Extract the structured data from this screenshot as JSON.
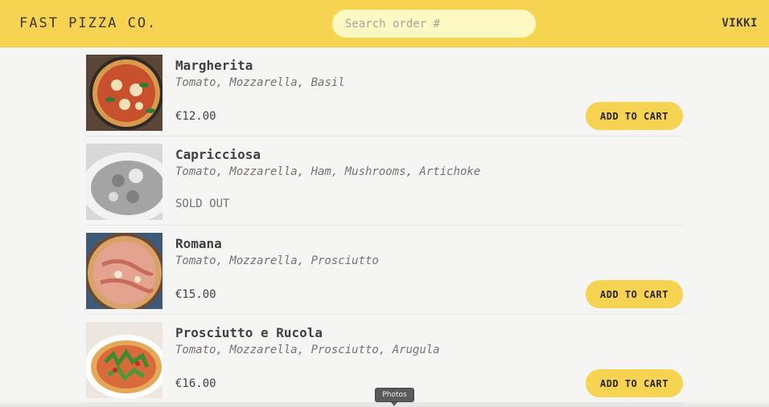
{
  "header": {
    "brand": "FAST PIZZA CO.",
    "search_placeholder": "Search order #",
    "username": "VIKKI"
  },
  "menu": {
    "items": [
      {
        "name": "Margherita",
        "ingredients": "Tomato, Mozzarella, Basil",
        "price": "€12.00",
        "button": "ADD TO CART",
        "sold_out": false
      },
      {
        "name": "Capricciosa",
        "ingredients": "Tomato, Mozzarella, Ham, Mushrooms, Artichoke",
        "status": "SOLD OUT",
        "sold_out": true
      },
      {
        "name": "Romana",
        "ingredients": "Tomato, Mozzarella, Prosciutto",
        "price": "€15.00",
        "button": "ADD TO CART",
        "sold_out": false
      },
      {
        "name": "Prosciutto e Rucola",
        "ingredients": "Tomato, Mozzarella, Prosciutto, Arugula",
        "price": "€16.00",
        "button": "ADD TO CART",
        "sold_out": false
      }
    ]
  },
  "tooltip": {
    "label": "Photos"
  },
  "colors": {
    "accent": "#f7d352",
    "background": "#f5f5f4",
    "search_bg": "#fef9c3"
  }
}
